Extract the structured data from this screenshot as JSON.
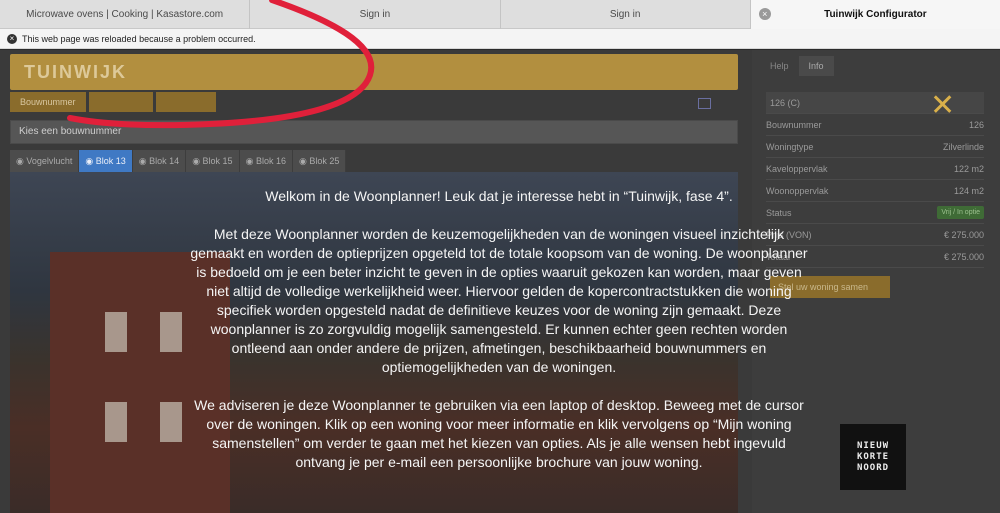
{
  "tabs": [
    {
      "label": "Microwave ovens | Cooking | Kasastore.com"
    },
    {
      "label": "Sign in"
    },
    {
      "label": "Sign in"
    },
    {
      "label": "Tuinwijk Configurator",
      "active": true
    }
  ],
  "infobar": {
    "message": "This web page was reloaded because a problem occurred."
  },
  "app": {
    "logo": "TUINWIJK",
    "breadcrumbs": [
      "Bouwnummer",
      "",
      ""
    ],
    "chooser_label": "Kies een bouwnummer",
    "block_tabs": [
      "Vogelvlucht",
      "Blok 13",
      "Blok 14",
      "Blok 15",
      "Blok 16",
      "Blok 25"
    ],
    "active_block": "Blok 13"
  },
  "info_panel": {
    "tabs": [
      "Help",
      "Info"
    ],
    "header": "126 (C)",
    "rows": [
      {
        "label": "Bouwnummer",
        "value": "126"
      },
      {
        "label": "Woningtype",
        "value": "Zilverlinde"
      },
      {
        "label": "Kaveloppervlak",
        "value": "122 m2"
      },
      {
        "label": "Woonoppervlak",
        "value": "124 m2"
      },
      {
        "label": "Status",
        "value": "Vrij / In optie"
      },
      {
        "label": "Prijs (VON)",
        "value": "€ 275.000"
      },
      {
        "label": "Totaal",
        "value": "€ 275.000"
      }
    ],
    "compose_button": "Stel uw woning samen"
  },
  "modal": {
    "paragraphs": [
      "Welkom in de Woonplanner! Leuk dat je interesse hebt in “Tuinwijk, fase 4”.",
      "Met deze Woonplanner worden de keuzemogelijkheden van de woningen visueel inzichtelijk gemaakt en worden de optieprijzen opgeteld tot de totale koopsom van de woning. De woonplanner is bedoeld om je een beter inzicht te geven in de opties waaruit gekozen kan worden, maar geven niet altijd de volledige werkelijkheid weer. Hiervoor gelden de kopercontractstukken die woning specifiek worden opgesteld nadat de definitieve keuzes voor de woning zijn gemaakt. Deze woonplanner is zo zorgvuldig mogelijk samengesteld. Er kunnen echter geen rechten worden ontleend aan onder andere de prijzen, afmetingen, beschikbaarheid bouwnummers en optiemogelijkheden van de woningen.",
      "We adviseren je deze Woonplanner te gebruiken via een laptop of desktop. Beweeg met de cursor over de woningen. Klik op een woning voor meer informatie en klik vervolgens op “Mijn woning samenstellen” om verder te gaan met het kiezen van opties. Als je alle wensen hebt ingevuld ontvang je per e-mail een persoonlijke brochure van jouw woning."
    ]
  },
  "nkn_logo": [
    "NIEUW",
    "KORTE",
    "NOORD"
  ],
  "icons": {
    "close": "close-x-icon",
    "warning": "warning-icon",
    "external": "external-link-icon",
    "eye": "eye-icon"
  },
  "colors": {
    "accent": "#d9b04a",
    "annotation": "#e0203a",
    "active_tab": "#3f79c4"
  }
}
